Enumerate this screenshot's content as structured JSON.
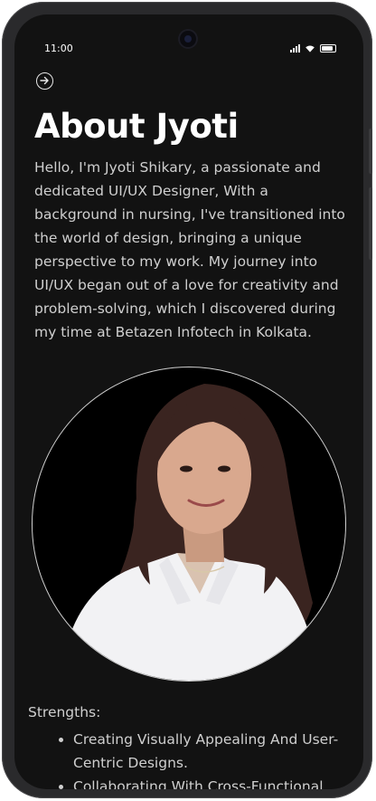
{
  "status_bar": {
    "time": "11:00"
  },
  "page": {
    "title": "About Jyoti",
    "bio": "Hello, I'm Jyoti Shikary, a passionate and dedicated UI/UX Designer, With a background in nursing, I've transitioned into the world of design, bringing a unique perspective to my work. My journey into UI/UX began out of a love for creativity and problem-solving, which I discovered during my time at Betazen Infotech in Kolkata."
  },
  "strengths": {
    "label": "Strengths:",
    "items": [
      "Creating Visually Appealing And User-Centric Designs.",
      "Collaborating With Cross-Functional"
    ]
  },
  "icons": {
    "back": "arrow-circle-right-icon",
    "signal": "signal-icon",
    "wifi": "wifi-icon",
    "battery": "battery-icon"
  },
  "colors": {
    "background": "#121212",
    "title": "#ffffff",
    "body_text": "#cfcfcf",
    "frame": "#2a2a2c"
  }
}
